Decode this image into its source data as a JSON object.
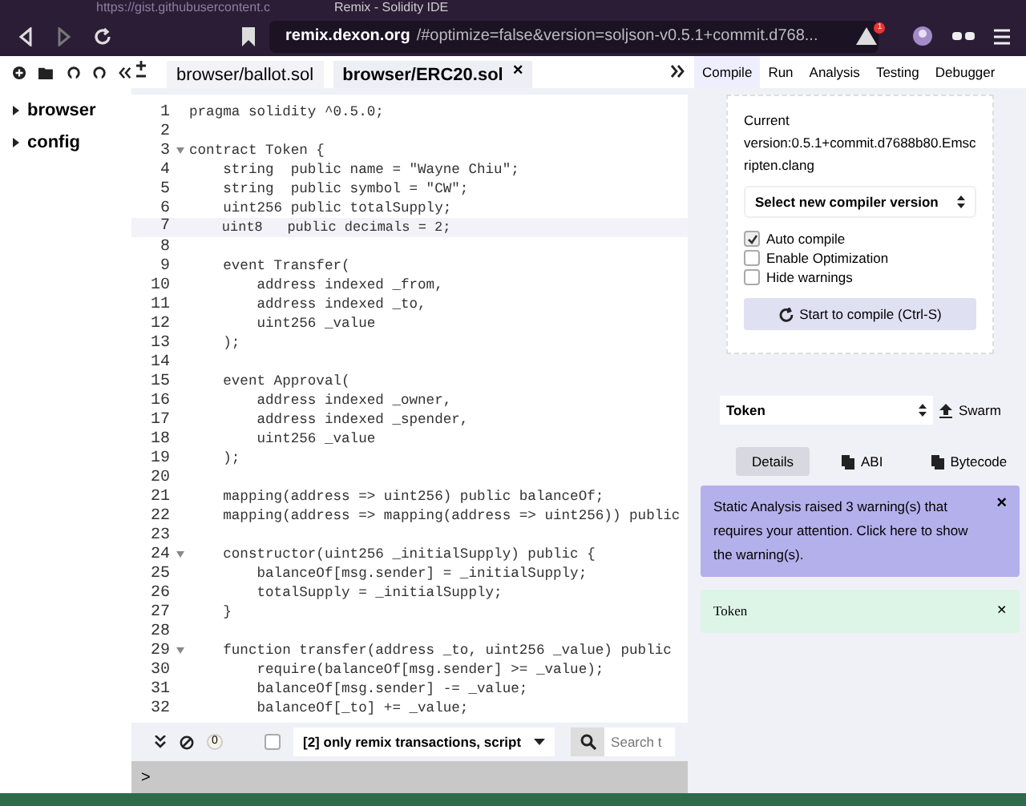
{
  "browser": {
    "tabs": [
      {
        "title": "https://gist.githubusercontent.c",
        "selected": false
      },
      {
        "title": "Remix - Solidity IDE",
        "selected": true
      }
    ],
    "url_host": "remix.dexon.org",
    "url_rest": "/#optimize=false&version=soljson-v0.5.1+commit.d768...",
    "alert_badge": "1"
  },
  "editor_tabs": [
    {
      "label": "browser/ballot.sol",
      "selected": false
    },
    {
      "label": "browser/ERC20.sol",
      "selected": true,
      "close": "×"
    }
  ],
  "file_tree": [
    {
      "label": "browser",
      "expanded": false
    },
    {
      "label": "config",
      "expanded": false
    }
  ],
  "panel_tabs": [
    {
      "label": "Compile",
      "selected": true
    },
    {
      "label": "Run",
      "selected": false
    },
    {
      "label": "Analysis",
      "selected": false
    },
    {
      "label": "Testing",
      "selected": false
    },
    {
      "label": "Debugger",
      "selected": false
    }
  ],
  "code": [
    {
      "n": "1",
      "text": "pragma solidity ^0.5.0;",
      "fold": false,
      "current": false
    },
    {
      "n": "2",
      "fold": false,
      "current": false
    },
    {
      "n": "3",
      "text": "contract Token {",
      "fold": true,
      "current": false
    },
    {
      "n": "4",
      "text": "    string  public name = \"Wayne Chiu\";",
      "fold": false,
      "current": false
    },
    {
      "n": "5",
      "text": "    string  public symbol = \"CW\";",
      "fold": false,
      "current": false
    },
    {
      "n": "6",
      "text": "    uint256 public totalSupply;",
      "fold": false,
      "current": false
    },
    {
      "n": "7",
      "text": "    uint8   public decimals = 2;",
      "fold": false,
      "current": true
    },
    {
      "n": "8",
      "fold": false,
      "current": false
    },
    {
      "n": "9",
      "text": "    event Transfer(",
      "fold": false,
      "current": false
    },
    {
      "n": "10",
      "text": "        address indexed _from,",
      "fold": false,
      "current": false
    },
    {
      "n": "11",
      "text": "        address indexed _to,",
      "fold": false,
      "current": false
    },
    {
      "n": "12",
      "text": "        uint256 _value",
      "fold": false,
      "current": false
    },
    {
      "n": "13",
      "text": "    );",
      "fold": false,
      "current": false
    },
    {
      "n": "14",
      "fold": false,
      "current": false
    },
    {
      "n": "15",
      "text": "    event Approval(",
      "fold": false,
      "current": false
    },
    {
      "n": "16",
      "text": "        address indexed _owner,",
      "fold": false,
      "current": false
    },
    {
      "n": "17",
      "text": "        address indexed _spender,",
      "fold": false,
      "current": false
    },
    {
      "n": "18",
      "text": "        uint256 _value",
      "fold": false,
      "current": false
    },
    {
      "n": "19",
      "text": "    );",
      "fold": false,
      "current": false
    },
    {
      "n": "20",
      "fold": false,
      "current": false
    },
    {
      "n": "21",
      "text": "    mapping(address => uint256) public balanceOf;",
      "fold": false,
      "current": false
    },
    {
      "n": "22",
      "text": "    mapping(address => mapping(address => uint256)) public",
      "fold": false,
      "current": false
    },
    {
      "n": "23",
      "fold": false,
      "current": false
    },
    {
      "n": "24",
      "text": "    constructor(uint256 _initialSupply) public {",
      "fold": true,
      "current": false
    },
    {
      "n": "25",
      "text": "        balanceOf[msg.sender] = _initialSupply;",
      "fold": false,
      "current": false
    },
    {
      "n": "26",
      "text": "        totalSupply = _initialSupply;",
      "fold": false,
      "current": false
    },
    {
      "n": "27",
      "text": "    }",
      "fold": false,
      "current": false
    },
    {
      "n": "28",
      "fold": false,
      "current": false
    },
    {
      "n": "29",
      "text": "    function transfer(address _to, uint256 _value) public",
      "fold": true,
      "current": false
    },
    {
      "n": "30",
      "text": "        require(balanceOf[msg.sender] >= _value);",
      "fold": false,
      "current": false
    },
    {
      "n": "31",
      "text": "        balanceOf[msg.sender] -= _value;",
      "fold": false,
      "current": false
    },
    {
      "n": "32",
      "text": "        balanceOf[_to] += _value;",
      "fold": false,
      "current": false
    }
  ],
  "terminal": {
    "count": "0",
    "listen_checked": false,
    "filter": "[2] only remix transactions, script",
    "search_placeholder": "Search t",
    "prompt": ">"
  },
  "compiler": {
    "current_label": "Current",
    "current_version": "version:0.5.1+commit.d7688b80.Emscripten.clang",
    "version_select": "Select new compiler version",
    "options": [
      {
        "label": "Auto compile",
        "checked": true
      },
      {
        "label": "Enable Optimization",
        "checked": false
      },
      {
        "label": "Hide warnings",
        "checked": false
      }
    ],
    "compile_button": "Start to compile (Ctrl-S)"
  },
  "contract": {
    "select": "Token",
    "swarm": "Swarm",
    "buttons": [
      {
        "label": "Details",
        "selected": true
      },
      {
        "label": "ABI",
        "selected": false
      },
      {
        "label": "Bytecode",
        "selected": false
      }
    ]
  },
  "alerts": [
    {
      "kind": "warning",
      "text": "Static Analysis raised 3 warning(s) that requires your attention. Click here to show the warning(s).",
      "close": "×"
    },
    {
      "kind": "success",
      "text": "Token",
      "close": "×"
    }
  ]
}
